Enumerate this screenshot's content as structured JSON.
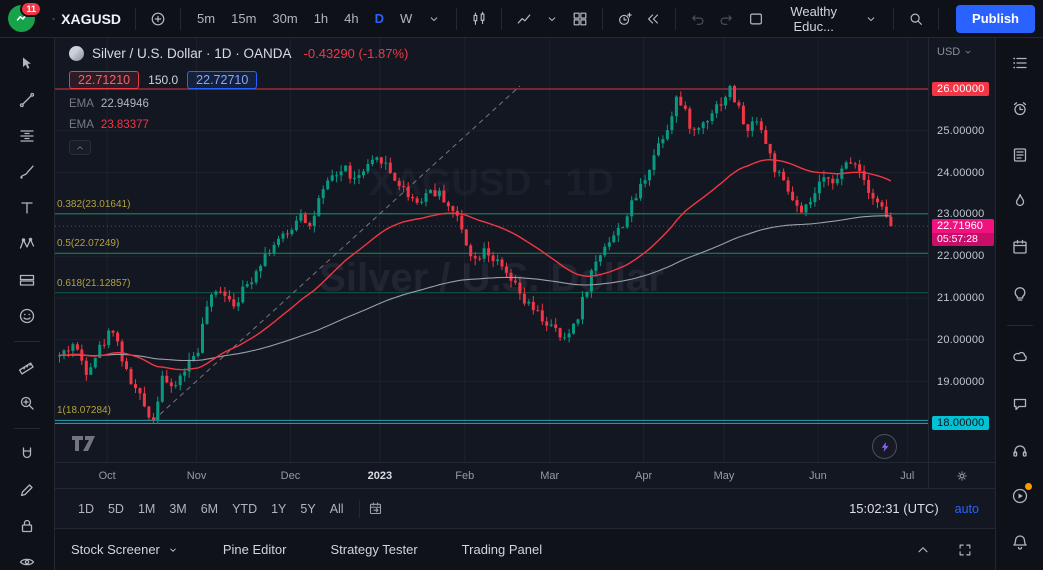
{
  "topbar": {
    "badge_count": "11",
    "symbol": "XAGUSD",
    "intervals": [
      "5m",
      "15m",
      "30m",
      "1h",
      "4h",
      "D",
      "W"
    ],
    "active_interval": "D",
    "layout_name": "Wealthy Educ...",
    "publish_label": "Publish",
    "items": [
      {
        "t": "logo"
      },
      {
        "t": "iconbtn",
        "name": "symbol-search-button",
        "icon": "search",
        "bind": "topbar.symbol",
        "big": true
      },
      {
        "t": "sep"
      },
      {
        "t": "iconbtn",
        "name": "compare-add-symbol-button",
        "icon": "plus-circle"
      },
      {
        "t": "sep"
      },
      {
        "t": "intervals"
      },
      {
        "t": "iconbtn",
        "name": "interval-menu-caret",
        "icon": "caret"
      },
      {
        "t": "sep"
      },
      {
        "t": "iconbtn",
        "name": "chart-style-button",
        "icon": "candles"
      },
      {
        "t": "sep"
      },
      {
        "t": "iconbtn",
        "name": "indicators-button",
        "icon": "line-chart"
      },
      {
        "t": "iconbtn",
        "name": "indicators-caret",
        "icon": "caret"
      },
      {
        "t": "iconbtn",
        "name": "multichart-layout-button",
        "icon": "grid"
      },
      {
        "t": "sep"
      },
      {
        "t": "iconbtn",
        "name": "create-alert-button",
        "icon": "alarm-plus"
      },
      {
        "t": "iconbtn",
        "name": "bar-replay-button",
        "icon": "replay"
      },
      {
        "t": "sep"
      },
      {
        "t": "iconbtn",
        "name": "undo-button",
        "icon": "undo",
        "dim": true
      },
      {
        "t": "iconbtn",
        "name": "redo-button",
        "icon": "redo",
        "dim": true
      },
      {
        "t": "spacer"
      },
      {
        "t": "iconbtn",
        "name": "save-layout-button",
        "icon": "square"
      },
      {
        "t": "iconbtn",
        "name": "layout-name-button",
        "bind": "topbar.layout_name"
      },
      {
        "t": "iconbtn",
        "name": "layout-menu-caret",
        "icon": "caret"
      },
      {
        "t": "sep"
      },
      {
        "t": "iconbtn",
        "name": "quick-search-button",
        "icon": "search"
      },
      {
        "t": "sep"
      },
      {
        "t": "publish"
      }
    ]
  },
  "legend": {
    "title": "Silver / U.S. Dollar · 1D · OANDA",
    "change": "-0.43290 (-1.87%)",
    "bid": "22.71210",
    "spread": "150.0",
    "ask": "22.72710",
    "indicators": [
      {
        "label": "EMA",
        "value": "22.94946",
        "color": "#b2b5be"
      },
      {
        "label": "EMA",
        "value": "23.83377",
        "color": "#f23645"
      }
    ]
  },
  "watermark": {
    "line1": "XAGUSD · 1D",
    "line2": "Silver / U.S. Dollar"
  },
  "price_axis": {
    "currency": "USD",
    "ticks": [
      {
        "text": "26.00000",
        "price": 26.0,
        "style": "red"
      },
      {
        "text": "25.00000",
        "price": 25.0,
        "style": "plain"
      },
      {
        "text": "24.00000",
        "price": 24.0,
        "style": "plain"
      },
      {
        "text": "23.00000",
        "price": 23.0,
        "style": "plain"
      },
      {
        "text": "22.00000",
        "price": 22.0,
        "style": "plain"
      },
      {
        "text": "21.00000",
        "price": 21.0,
        "style": "plain"
      },
      {
        "text": "20.00000",
        "price": 20.0,
        "style": "plain"
      },
      {
        "text": "19.00000",
        "price": 19.0,
        "style": "plain"
      },
      {
        "text": "18.00000",
        "price": 18.0,
        "style": "cyan"
      }
    ],
    "last": {
      "text": "22.71960",
      "price": 22.7196,
      "countdown": "05:57:28"
    }
  },
  "fib_labels": [
    {
      "text": "0.382(23.01641)",
      "price": 23.01641
    },
    {
      "text": "0.5(22.07249)",
      "price": 22.07249
    },
    {
      "text": "0.618(21.12857)",
      "price": 21.12857
    },
    {
      "text": "1(18.07284)",
      "price": 18.07284
    }
  ],
  "time_axis": [
    {
      "label": "Oct",
      "day": 11
    },
    {
      "label": "Nov",
      "day": 31
    },
    {
      "label": "Dec",
      "day": 52
    },
    {
      "label": "2023",
      "day": 72,
      "major": true
    },
    {
      "label": "Feb",
      "day": 91
    },
    {
      "label": "Mar",
      "day": 110
    },
    {
      "label": "Apr",
      "day": 131
    },
    {
      "label": "May",
      "day": 149
    },
    {
      "label": "Jun",
      "day": 170
    },
    {
      "label": "Jul",
      "day": 190
    }
  ],
  "range_bar": {
    "ranges": [
      "1D",
      "5D",
      "1M",
      "3M",
      "6M",
      "YTD",
      "1Y",
      "5Y",
      "All"
    ],
    "clock": "15:02:31 (UTC)",
    "scale": "auto"
  },
  "bottom_tabs": [
    {
      "label": "Stock Screener",
      "caret": true
    },
    {
      "label": "Pine Editor"
    },
    {
      "label": "Strategy Tester"
    },
    {
      "label": "Trading Panel"
    }
  ],
  "left_toolbar": [
    "cursor",
    "trendline",
    "fib-retracement",
    "brush",
    "text",
    "xabcd-pattern",
    "long-position",
    "emoji",
    "ruler",
    "zoom",
    "magnet",
    "edit",
    "lock",
    "eye"
  ],
  "right_toolbar": [
    "watchlist",
    "alerts",
    "news",
    "hotlists",
    "calendar",
    "ideas",
    "chats",
    "comments",
    "streams",
    "tutorials",
    "notifications"
  ],
  "chart_data": {
    "type": "candlestick",
    "symbol": "XAGUSD",
    "interval": "1D",
    "visible_range": {
      "from": "Oct 2022",
      "to": "Jul 2023"
    },
    "last_price": 22.7196,
    "change": "-0.43290 (-1.87%)",
    "colors": {
      "up": "#089981",
      "down": "#f23645"
    },
    "price_axis_ticks": [
      26,
      25,
      24,
      23,
      22,
      21,
      20,
      19,
      18
    ],
    "levels": [
      {
        "price": 26.0,
        "color": "#f23645",
        "opacity": 0.9,
        "label": "26.00000"
      },
      {
        "price": 23.01641,
        "color": "#0a9a60",
        "opacity": 0.95,
        "label": "fib 0.382"
      },
      {
        "price": 22.07249,
        "color": "#0a9a60",
        "opacity": 0.95,
        "label": "fib 0.5"
      },
      {
        "price": 21.12857,
        "color": "#0a9a60",
        "opacity": 0.5,
        "label": "fib 0.618"
      },
      {
        "price": 18.07284,
        "color": "#26c6da",
        "opacity": 0.8,
        "label": "fib 1"
      },
      {
        "price": 18.0,
        "color": "#00c2d4",
        "opacity": 0.95,
        "label": "18.00000"
      }
    ],
    "fib_trendline": {
      "from_day": 21,
      "from_price": 18.07284,
      "to_day": 103,
      "to_price": 26.07214,
      "style": "dashed"
    },
    "emas": [
      {
        "period": 150,
        "color": "#9aa0a6",
        "last": 22.94946
      },
      {
        "period": 45,
        "color": "#f23645",
        "last": 23.83377
      }
    ],
    "price_anchors": [
      [
        0,
        19.6
      ],
      [
        3,
        19.9
      ],
      [
        6,
        19.3
      ],
      [
        9,
        19.8
      ],
      [
        12,
        20.3
      ],
      [
        15,
        19.2
      ],
      [
        18,
        18.6
      ],
      [
        21,
        18.08
      ],
      [
        23,
        19.2
      ],
      [
        25,
        18.75
      ],
      [
        28,
        19.3
      ],
      [
        31,
        19.8
      ],
      [
        33,
        20.8
      ],
      [
        36,
        21.25
      ],
      [
        39,
        20.9
      ],
      [
        42,
        21.3
      ],
      [
        45,
        21.9
      ],
      [
        48,
        22.3
      ],
      [
        51,
        22.5
      ],
      [
        54,
        23.1
      ],
      [
        56,
        22.7
      ],
      [
        58,
        23.3
      ],
      [
        61,
        23.9
      ],
      [
        64,
        24.1
      ],
      [
        66,
        23.8
      ],
      [
        69,
        24.1
      ],
      [
        72,
        24.35
      ],
      [
        74,
        24.0
      ],
      [
        77,
        23.6
      ],
      [
        80,
        23.3
      ],
      [
        83,
        23.6
      ],
      [
        86,
        23.4
      ],
      [
        89,
        22.9
      ],
      [
        91,
        22.35
      ],
      [
        93,
        21.9
      ],
      [
        95,
        22.25
      ],
      [
        98,
        21.8
      ],
      [
        101,
        21.4
      ],
      [
        104,
        20.9
      ],
      [
        107,
        20.6
      ],
      [
        110,
        20.3
      ],
      [
        113,
        19.95
      ],
      [
        116,
        20.6
      ],
      [
        119,
        21.6
      ],
      [
        122,
        22.3
      ],
      [
        125,
        22.6
      ],
      [
        128,
        23.2
      ],
      [
        131,
        23.9
      ],
      [
        134,
        24.7
      ],
      [
        136,
        25.1
      ],
      [
        138,
        25.8
      ],
      [
        140,
        25.4
      ],
      [
        142,
        24.95
      ],
      [
        144,
        25.2
      ],
      [
        146,
        25.5
      ],
      [
        148,
        25.7
      ],
      [
        150,
        26.0
      ],
      [
        152,
        25.5
      ],
      [
        154,
        24.95
      ],
      [
        156,
        25.35
      ],
      [
        158,
        24.7
      ],
      [
        160,
        24.1
      ],
      [
        162,
        23.7
      ],
      [
        164,
        23.35
      ],
      [
        166,
        22.95
      ],
      [
        168,
        23.3
      ],
      [
        170,
        23.65
      ],
      [
        172,
        23.95
      ],
      [
        174,
        23.8
      ],
      [
        176,
        24.2
      ],
      [
        178,
        24.3
      ],
      [
        180,
        23.85
      ],
      [
        182,
        23.45
      ],
      [
        184,
        23.15
      ],
      [
        186,
        22.72
      ]
    ]
  }
}
